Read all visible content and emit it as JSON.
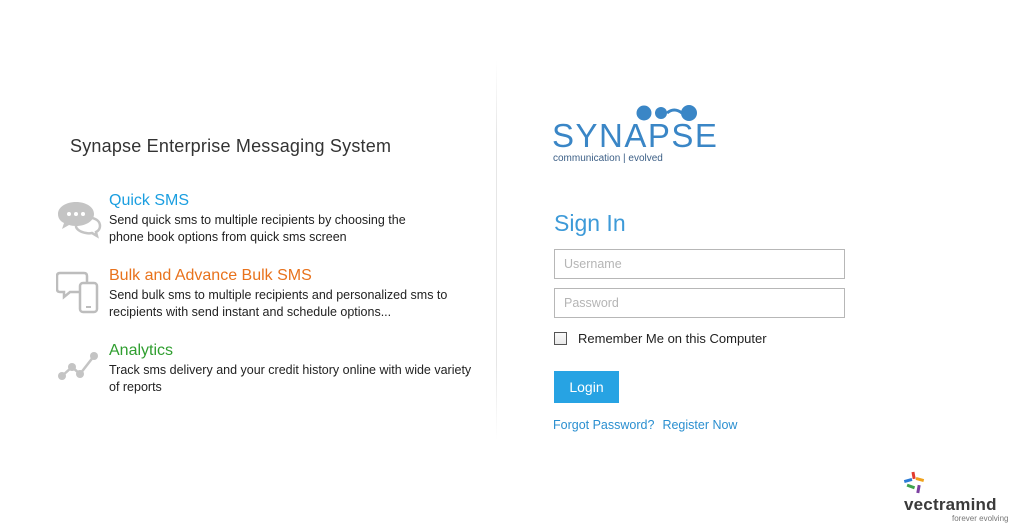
{
  "left": {
    "title": "Synapse Enterprise Messaging System",
    "features": [
      {
        "title": "Quick SMS",
        "desc_line1": "Send quick sms to multiple recipients by choosing the",
        "desc_line2": "phone book options from quick sms screen",
        "icon": "chat-bubbles-icon",
        "color": "#1a9ee0"
      },
      {
        "title": "Bulk and Advance Bulk SMS",
        "desc_line1": "Send bulk sms to multiple recipients and personalized sms to",
        "desc_line2": "recipients with send instant and schedule options...",
        "icon": "mobile-chat-icon",
        "color": "#e8721c"
      },
      {
        "title": "Analytics",
        "desc_line1": "Track sms delivery and your credit history online with wide variety",
        "desc_line2": "of reports",
        "icon": "line-graph-icon",
        "color": "#2f9e2f"
      }
    ]
  },
  "logo": {
    "word": "SYNAPSE",
    "tagline": "communication | evolved"
  },
  "signin": {
    "title": "Sign In",
    "username_placeholder": "Username",
    "password_placeholder": "Password",
    "remember_label": "Remember Me on this Computer",
    "login_label": "Login",
    "forgot_label": "Forgot Password?",
    "register_label": "Register Now",
    "accent": "#27a3e3"
  },
  "brand": {
    "word": "vectramind",
    "tagline": "forever evolving"
  }
}
